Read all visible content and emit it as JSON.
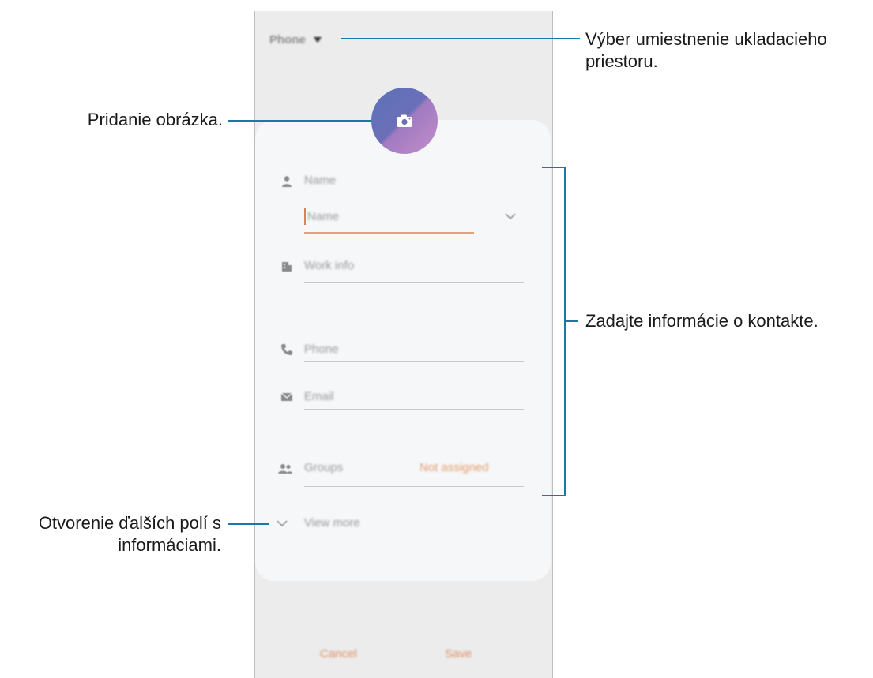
{
  "phone": {
    "storage_label": "Phone",
    "fields": {
      "name_section": "Name",
      "name_input_placeholder": "Name",
      "work_info": "Work info",
      "phone": "Phone",
      "email": "Email",
      "groups": "Groups",
      "groups_value": "Not assigned",
      "view_more": "View more"
    },
    "buttons": {
      "cancel": "Cancel",
      "save": "Save"
    },
    "accent_color": "#e08e63"
  },
  "callouts": {
    "storage": "Výber umiestnenie ukladacieho priestoru.",
    "picture": "Pridanie obrázka.",
    "contact_info": "Zadajte informácie o kontakte.",
    "more_fields": "Otvorenie ďalších polí s informáciami."
  },
  "icons": [
    "chevron-down-icon",
    "camera-icon",
    "person-icon",
    "building-icon",
    "phone-icon",
    "email-icon",
    "groups-icon"
  ]
}
